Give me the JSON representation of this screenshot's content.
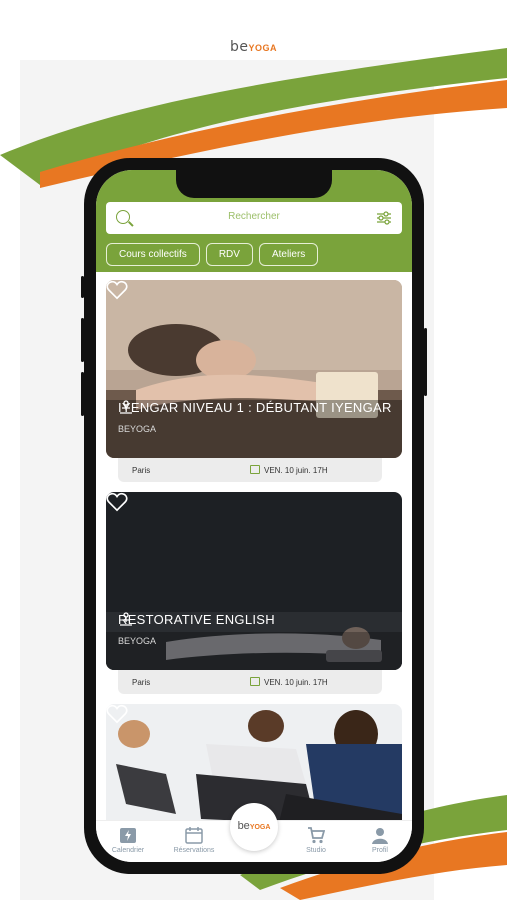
{
  "app": {
    "logo_be": "be",
    "logo_yoga": "YOGA"
  },
  "colors": {
    "accent_green": "#7aa33b",
    "accent_orange": "#e87722"
  },
  "search": {
    "placeholder": "Rechercher",
    "icon": "search-icon",
    "filter_icon": "sliders-icon"
  },
  "chips": [
    {
      "label": "Cours collectifs"
    },
    {
      "label": "RDV"
    },
    {
      "label": "Ateliers"
    }
  ],
  "cards": [
    {
      "title": "IYENGAR NIVEAU 1 : DÉBUTANT IYENGAR",
      "organization": "BEYOGA",
      "location": "Paris",
      "date": "VEN. 10 juin. 17H"
    },
    {
      "title": "RESTORATIVE ENGLISH",
      "organization": "BEYOGA",
      "location": "Paris",
      "date": "VEN. 10 juin. 17H"
    },
    {
      "title": "",
      "organization": "",
      "location": "",
      "date": ""
    }
  ],
  "tabbar": {
    "items": [
      {
        "label": "Calendrier",
        "icon": "calendar-bolt-icon"
      },
      {
        "label": "Réservations",
        "icon": "calendar-icon"
      },
      {
        "label": "Studio",
        "icon": "cart-icon"
      },
      {
        "label": "Profil",
        "icon": "user-icon"
      }
    ],
    "center_be": "be",
    "center_yoga": "YOGA"
  }
}
